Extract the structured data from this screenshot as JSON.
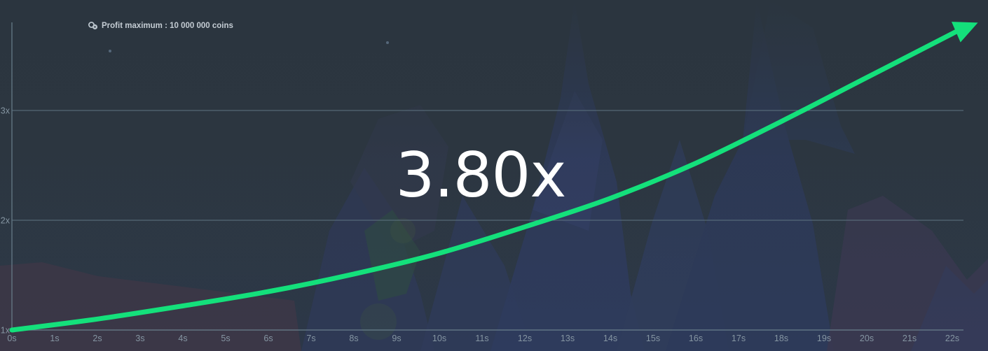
{
  "profit_banner": {
    "icon": "coins-icon",
    "text": "Profit maximum : 10 000 000 coins"
  },
  "multiplier": {
    "value": "3.80x"
  },
  "colors": {
    "curve": "#14e07b",
    "grid": "#5e7482",
    "tick_label": "#8595a2",
    "multiplier_text": "#ffffff"
  },
  "chart_data": {
    "type": "line",
    "title": "",
    "xlabel": "",
    "ylabel": "",
    "x_ticks": [
      "0s",
      "1s",
      "2s",
      "3s",
      "4s",
      "5s",
      "6s",
      "7s",
      "8s",
      "9s",
      "10s",
      "11s",
      "12s",
      "13s",
      "14s",
      "15s",
      "16s",
      "17s",
      "18s",
      "19s",
      "20s",
      "21s",
      "22s"
    ],
    "y_ticks": [
      "1x",
      "2x",
      "3x"
    ],
    "xlim": [
      0,
      22.3
    ],
    "ylim": [
      1,
      3.1
    ],
    "grid": true,
    "series": [
      {
        "x": [
          0,
          2,
          4,
          6,
          8,
          10,
          12,
          14,
          16,
          18,
          20,
          22,
          22.6
        ],
        "y": [
          1.0,
          1.1,
          1.22,
          1.35,
          1.51,
          1.7,
          1.94,
          2.2,
          2.52,
          2.9,
          3.3,
          3.7,
          3.8
        ],
        "marker": "arrow-end"
      }
    ]
  }
}
